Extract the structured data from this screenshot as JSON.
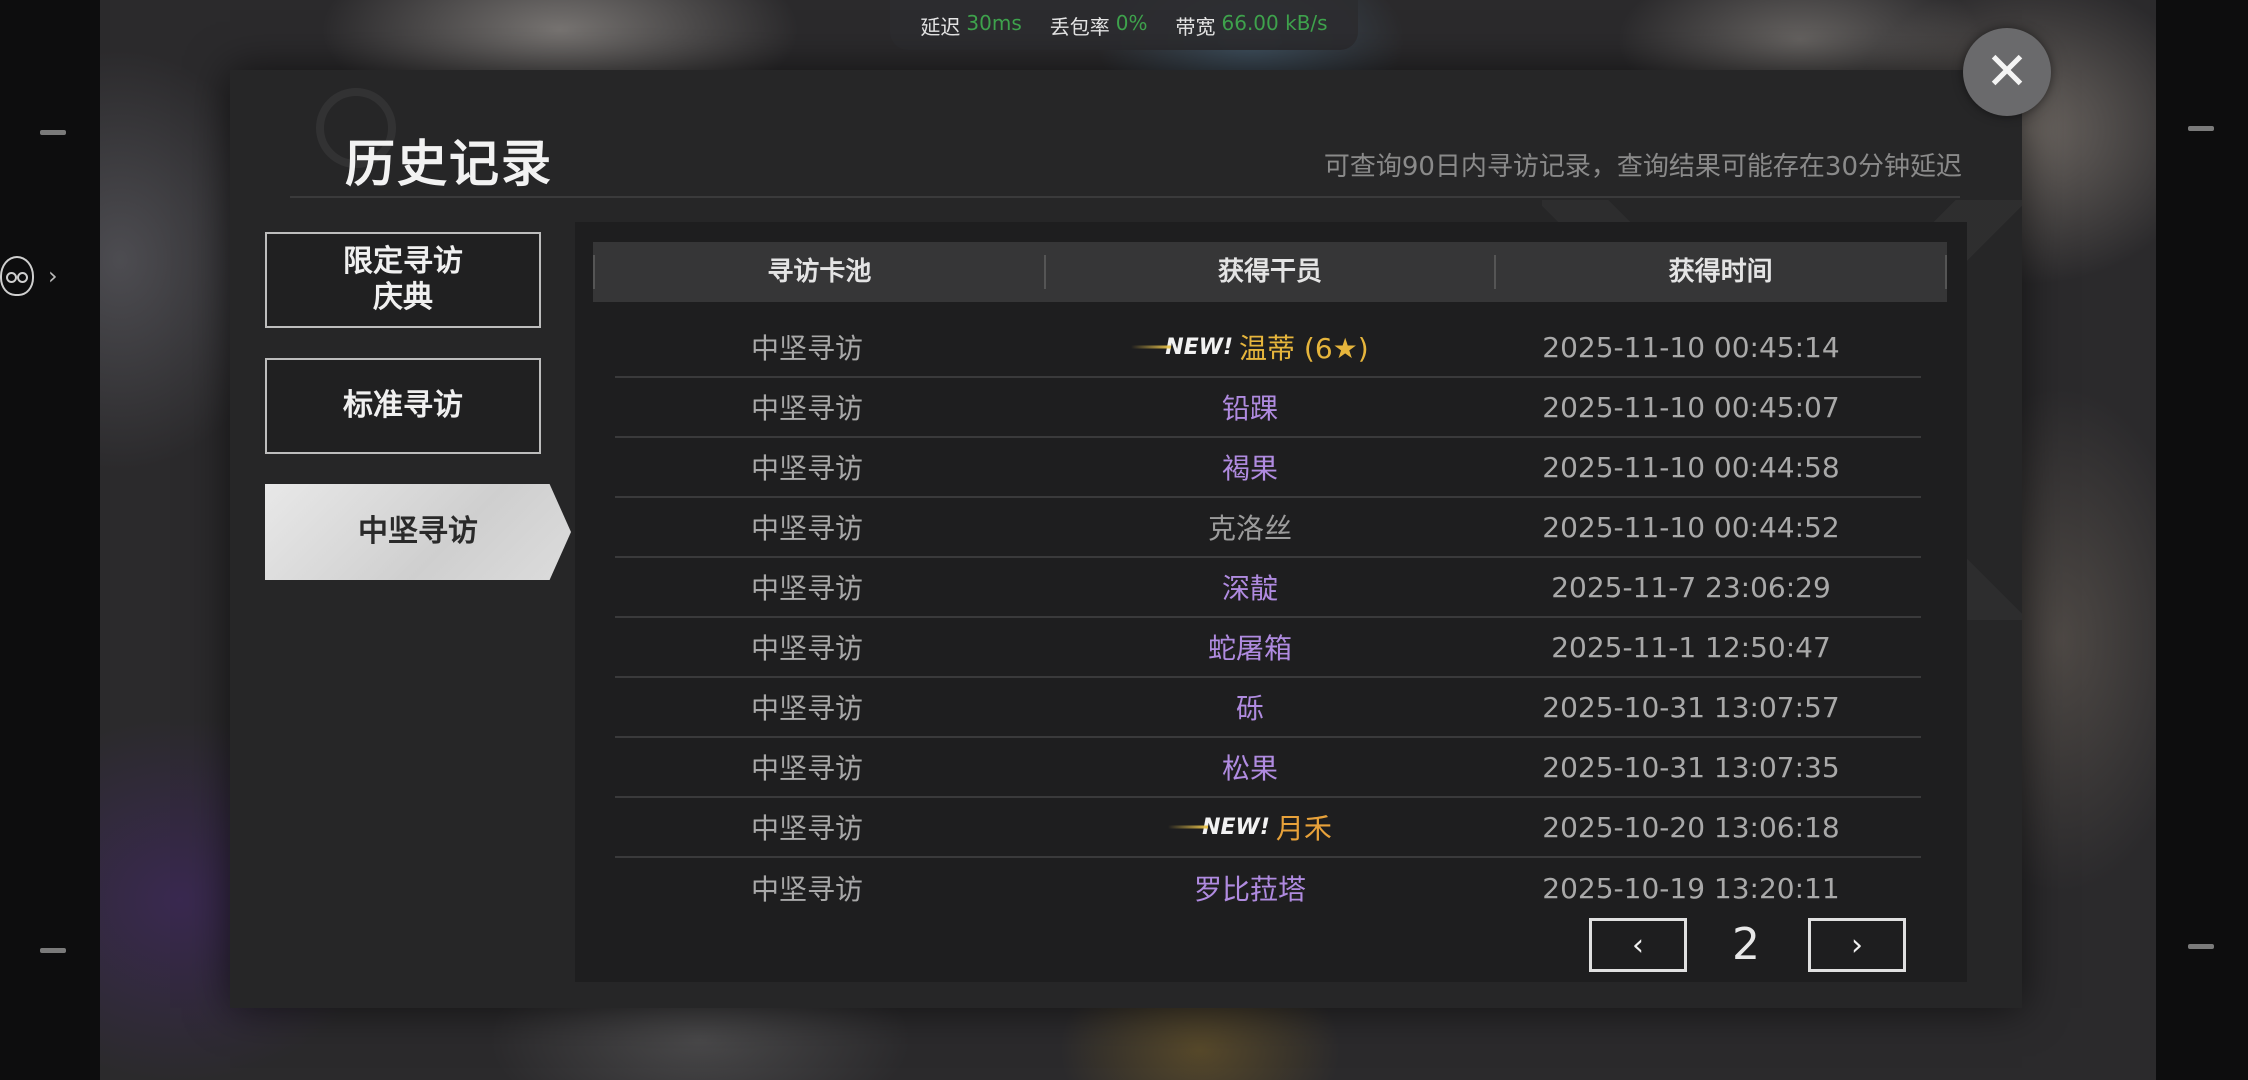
{
  "network": {
    "latency_label": "延迟",
    "latency_value": "30ms",
    "loss_label": "丢包率",
    "loss_value": "0%",
    "bandwidth_label": "带宽",
    "bandwidth_value": "66.00 kB/s",
    "value_color": "#3fa34d"
  },
  "header": {
    "title": "历史记录",
    "subtitle": "可查询90日内寻访记录，查询结果可能存在30分钟延迟"
  },
  "tabs": [
    {
      "label_line1": "限定寻访",
      "label_line2": "庆典",
      "active": false
    },
    {
      "label_line1": "标准寻访",
      "label_line2": "",
      "active": false
    },
    {
      "label_line1": "中坚寻访",
      "label_line2": "",
      "active": true
    }
  ],
  "table": {
    "columns": [
      "寻访卡池",
      "获得干员",
      "获得时间"
    ],
    "rows": [
      {
        "pool": "中坚寻访",
        "badge": "NEW!",
        "operator": "温蒂 (6★)",
        "time": "2025-11-10 00:45:14",
        "color": "#e6b53c"
      },
      {
        "pool": "中坚寻访",
        "badge": "",
        "operator": "铅踝",
        "time": "2025-11-10 00:45:07",
        "color": "#b08be0"
      },
      {
        "pool": "中坚寻访",
        "badge": "",
        "operator": "褐果",
        "time": "2025-11-10 00:44:58",
        "color": "#b08be0"
      },
      {
        "pool": "中坚寻访",
        "badge": "",
        "operator": "克洛丝",
        "time": "2025-11-10 00:44:52",
        "color": "#9c9c9c"
      },
      {
        "pool": "中坚寻访",
        "badge": "",
        "operator": "深靛",
        "time": "2025-11-7 23:06:29",
        "color": "#b08be0"
      },
      {
        "pool": "中坚寻访",
        "badge": "",
        "operator": "蛇屠箱",
        "time": "2025-11-1 12:50:47",
        "color": "#b08be0"
      },
      {
        "pool": "中坚寻访",
        "badge": "",
        "operator": "砾",
        "time": "2025-10-31 13:07:57",
        "color": "#b08be0"
      },
      {
        "pool": "中坚寻访",
        "badge": "",
        "operator": "松果",
        "time": "2025-10-31 13:07:35",
        "color": "#b08be0"
      },
      {
        "pool": "中坚寻访",
        "badge": "NEW!",
        "operator": "月禾",
        "time": "2025-10-20 13:06:18",
        "color": "#e8a23a"
      },
      {
        "pool": "中坚寻访",
        "badge": "",
        "operator": "罗比菈塔",
        "time": "2025-10-19 13:20:11",
        "color": "#b08be0"
      }
    ]
  },
  "pagination": {
    "prev_icon": "‹",
    "page": "2",
    "next_icon": "›"
  },
  "close_icon": "✕"
}
